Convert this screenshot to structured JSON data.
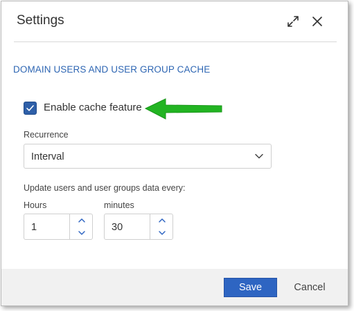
{
  "dialog": {
    "title": "Settings",
    "header_icons": [
      "expand-icon",
      "close-icon"
    ]
  },
  "section": {
    "title": "DOMAIN USERS AND USER GROUP CACHE"
  },
  "cache": {
    "checkbox_label": "Enable cache feature",
    "checked": true
  },
  "recurrence": {
    "label": "Recurrence",
    "selected": "Interval"
  },
  "update": {
    "label": "Update users and user groups data every:",
    "hours_label": "Hours",
    "hours_value": "1",
    "minutes_label": "minutes",
    "minutes_value": "30"
  },
  "footer": {
    "save_label": "Save",
    "cancel_label": "Cancel"
  },
  "colors": {
    "accent": "#2e65c2",
    "section_title": "#2e66b3",
    "annotation_arrow": "#22b422",
    "footer_bg": "#f1f1f1"
  }
}
